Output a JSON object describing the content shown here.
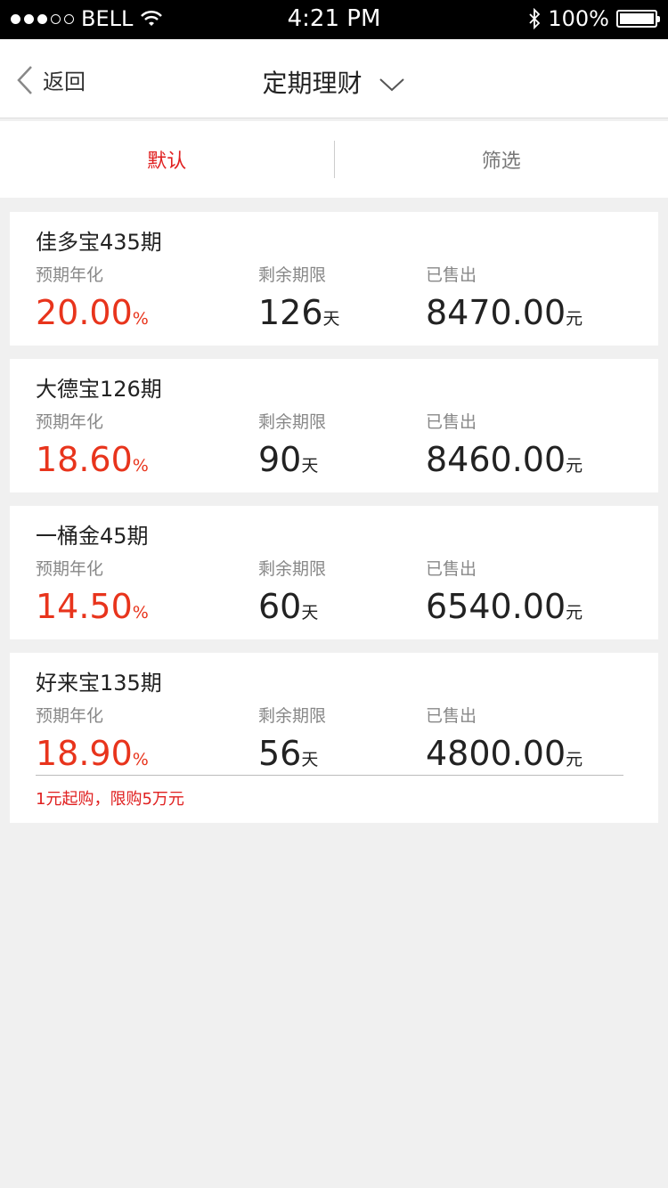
{
  "status_bar": {
    "carrier": "BELL",
    "time": "4:21 PM",
    "battery": "100%"
  },
  "nav": {
    "back_label": "返回",
    "title": "定期理财"
  },
  "tabs": [
    {
      "label": "默认",
      "active": true
    },
    {
      "label": "筛选",
      "active": false
    }
  ],
  "products": [
    {
      "name": "佳多宝435期",
      "rate_label": "预期年化",
      "rate": "20.00",
      "rate_unit": "%",
      "term_label": "剩余期限",
      "term": "126",
      "term_unit": "天",
      "sold_label": "已售出",
      "sold": "8470.00",
      "sold_unit": "元"
    },
    {
      "name": "大德宝126期",
      "rate_label": "预期年化",
      "rate": "18.60",
      "rate_unit": "%",
      "term_label": "剩余期限",
      "term": "90",
      "term_unit": "天",
      "sold_label": "已售出",
      "sold": "8460.00",
      "sold_unit": "元"
    },
    {
      "name": "一桶金45期",
      "rate_label": "预期年化",
      "rate": "14.50",
      "rate_unit": "%",
      "term_label": "剩余期限",
      "term": "60",
      "term_unit": "天",
      "sold_label": "已售出",
      "sold": "6540.00",
      "sold_unit": "元"
    },
    {
      "name": "好来宝135期",
      "rate_label": "预期年化",
      "rate": "18.90",
      "rate_unit": "%",
      "term_label": "剩余期限",
      "term": "56",
      "term_unit": "天",
      "sold_label": "已售出",
      "sold": "4800.00",
      "sold_unit": "元",
      "note": "1元起购，限购5万元"
    }
  ],
  "colors": {
    "accent_red": "#e02020",
    "rate_red": "#e8341c",
    "background": "#f0f0f0"
  }
}
